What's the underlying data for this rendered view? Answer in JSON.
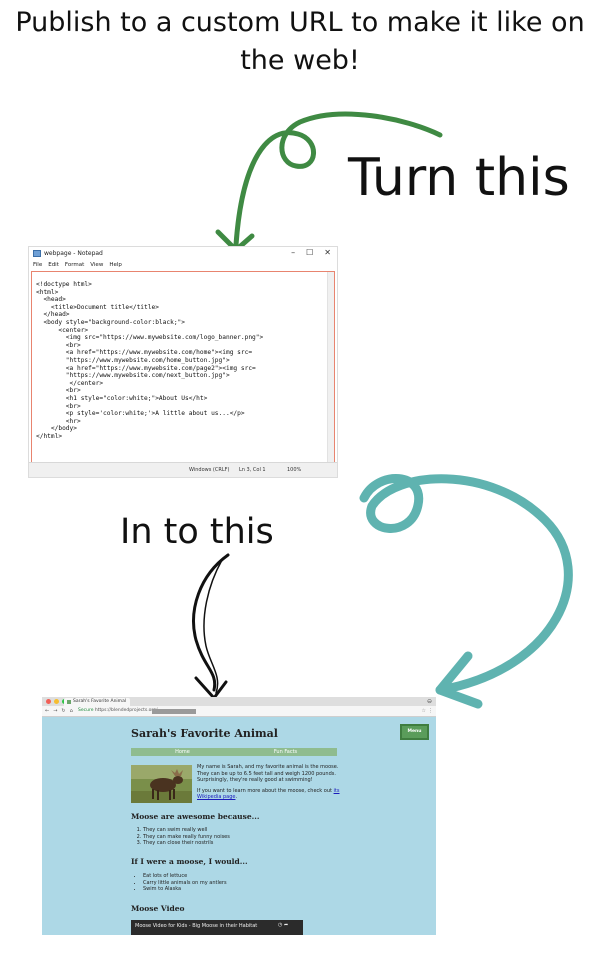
{
  "headline": {
    "line1": "Publish to a custom URL to make it like on",
    "line2": "the web!"
  },
  "labels": {
    "turn_this": "Turn this",
    "into_this": "In to this"
  },
  "colors": {
    "arrow_green": "#3f8a43",
    "arrow_teal": "#5fb3b0",
    "arrow_black": "#111111",
    "notepad_border": "#e8846f",
    "page_background": "#add8e6",
    "nav_green": "#8fbc8f",
    "menu_button": "#5a9c5a"
  },
  "notepad": {
    "title": "webpage - Notepad",
    "window_controls": [
      "–",
      "☐",
      "✕"
    ],
    "menu": [
      "File",
      "Edit",
      "Format",
      "View",
      "Help"
    ],
    "code_lines": [
      "<!doctype html>",
      "<html>",
      "  <head>",
      "    <title>Document title</title>",
      "  </head>",
      "  <body style=\"background-color:black;\">",
      "      <center>",
      "        <img src=\"https://www.mywebsite.com/logo_banner.png\">",
      "        <br>",
      "        <a href=\"https://www.mywebsite.com/home\"><img src=",
      "        \"https://www.mywebsite.com/home_button.jpg\">",
      "        <a href=\"https://www.mywebsite.com/page2\"><img src=",
      "        \"https://www.mywebsite.com/next_button.jpg\">",
      "         </center>",
      "        <br>",
      "        <h1 style=\"color:white;\">About Us</ht>",
      "        <br>",
      "        <p style='color:white;'>A little about us...</p>",
      "        <hr>",
      "    </body>",
      "</html>"
    ],
    "status": {
      "encoding": "Windows (CRLF)",
      "position": "Ln 3, Col 1",
      "zoom": "100%"
    }
  },
  "browser": {
    "tab_title": "Sarah's Favorite Animal",
    "secure_label": "Secure",
    "url": "https://blendedprojects.org/",
    "site": {
      "title": "Sarah's Favorite Animal",
      "menu_button": "Menu",
      "nav": [
        "Home",
        "Fun Facts"
      ],
      "intro_p1": "My name is Sarah, and my favorite animal is the moose. They can be up to 6.5 feet tall and weigh 1200 pounds. Surprisingly, they're really good at swimming!",
      "intro_p2_text": "If you want to learn more about the moose, check out ",
      "intro_p2_link": "its Wikipedia page",
      "intro_p2_end": ".",
      "section1_title": "Moose are awesome because...",
      "section1_items": [
        "They can swim really well",
        "They can make really funny noises",
        "They can close their nostrils"
      ],
      "section2_title": "If I were a moose, I would...",
      "section2_items": [
        "Eat lots of lettuce",
        "Carry little animals on my antlers",
        "Swim to Alaska"
      ],
      "video_heading": "Moose Video",
      "video_title": "Moose Video for Kids - Big Moose in their Habitat"
    }
  }
}
